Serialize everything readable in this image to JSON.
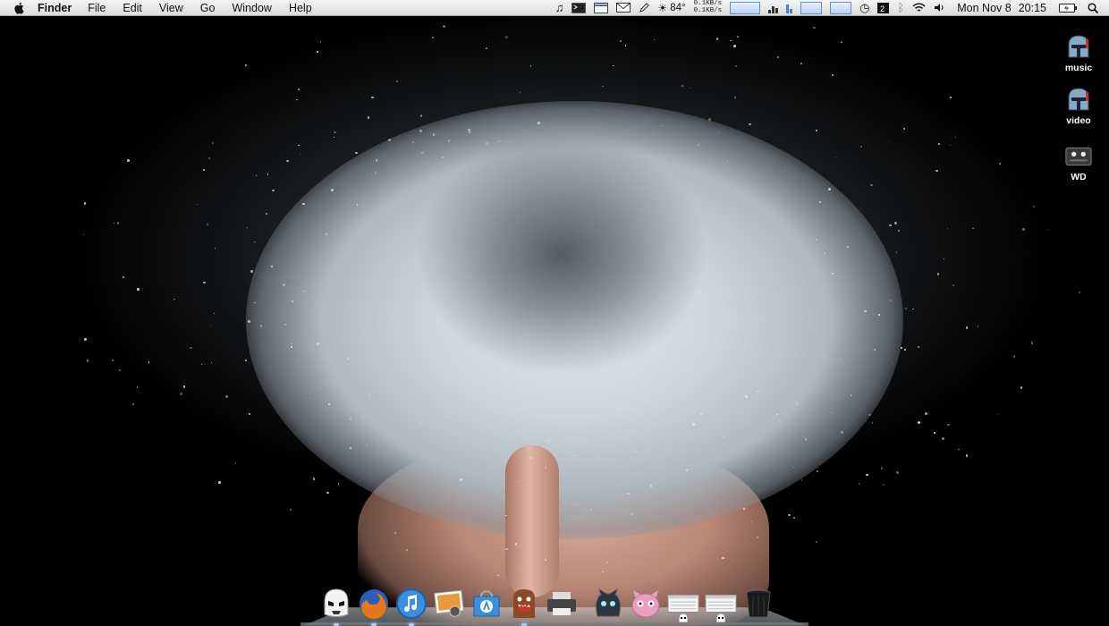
{
  "menubar": {
    "app_name": "Finder",
    "menus": [
      "File",
      "Edit",
      "View",
      "Go",
      "Window",
      "Help"
    ]
  },
  "status": {
    "temperature": "84°",
    "net_up": "0.1KB/s",
    "net_down": "0.1KB/s",
    "date": "Mon Nov 8",
    "time": "20:15"
  },
  "desktop_icons": [
    {
      "label": "music",
      "icon": "boba-fett-helmet-icon"
    },
    {
      "label": "video",
      "icon": "boba-fett-helmet-icon"
    },
    {
      "label": "WD",
      "icon": "external-drive-icon"
    }
  ],
  "dock": {
    "items": [
      "stormtrooper-icon",
      "firefox-icon",
      "itunes-icon",
      "iphoto-icon",
      "app-store-icon",
      "domo-icon",
      "printer-icon",
      "dark-creature-icon",
      "pink-creature-icon",
      "window-stack-icon",
      "window-stack-icon",
      "trash-icon"
    ]
  },
  "colors": {
    "menubar": "#e8e8e8",
    "accent_blue": "#3b82d8",
    "firefox_orange": "#e8761c"
  }
}
